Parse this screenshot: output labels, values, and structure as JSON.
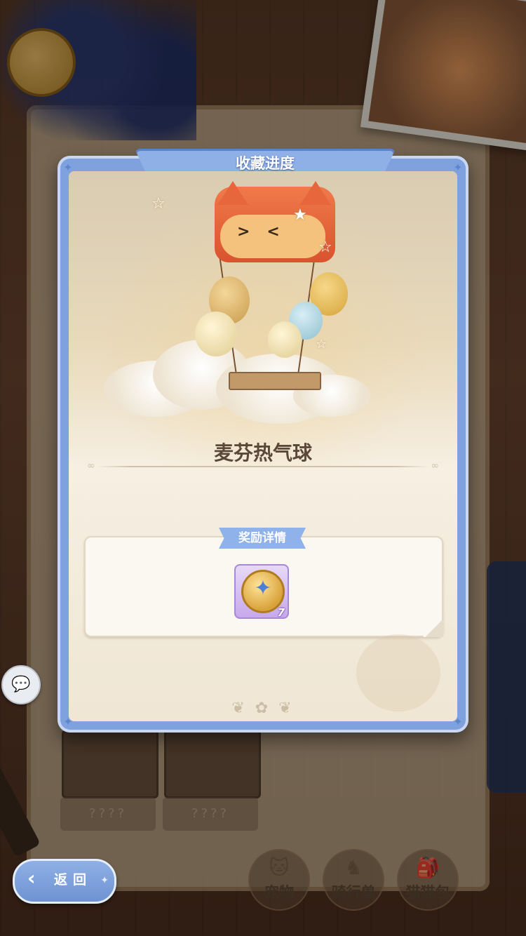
{
  "dialog": {
    "title": "收藏进度",
    "item_name": "麦芬热气球",
    "reward_section_title": "奖励详情",
    "reward_items": [
      {
        "icon": "star-coin-icon",
        "count": "7"
      }
    ]
  },
  "background": {
    "locked_cards": [
      {
        "label": "????"
      },
      {
        "label": "????"
      }
    ]
  },
  "back_button": {
    "label": "返回"
  },
  "bottom_tabs": [
    {
      "label": "宠物",
      "icon": "cat-head-icon"
    },
    {
      "label": "骑行兽",
      "icon": "horse-head-icon"
    },
    {
      "label": "猫猫包",
      "icon": "cat-bag-icon"
    }
  ],
  "chat_button": {
    "icon": "chat-bubble-icon"
  },
  "colors": {
    "panel_blue": "#7fa2de",
    "panel_inner": "#f2eada",
    "name_text": "#5a4838",
    "reward_tag": "#8fb2ea"
  }
}
